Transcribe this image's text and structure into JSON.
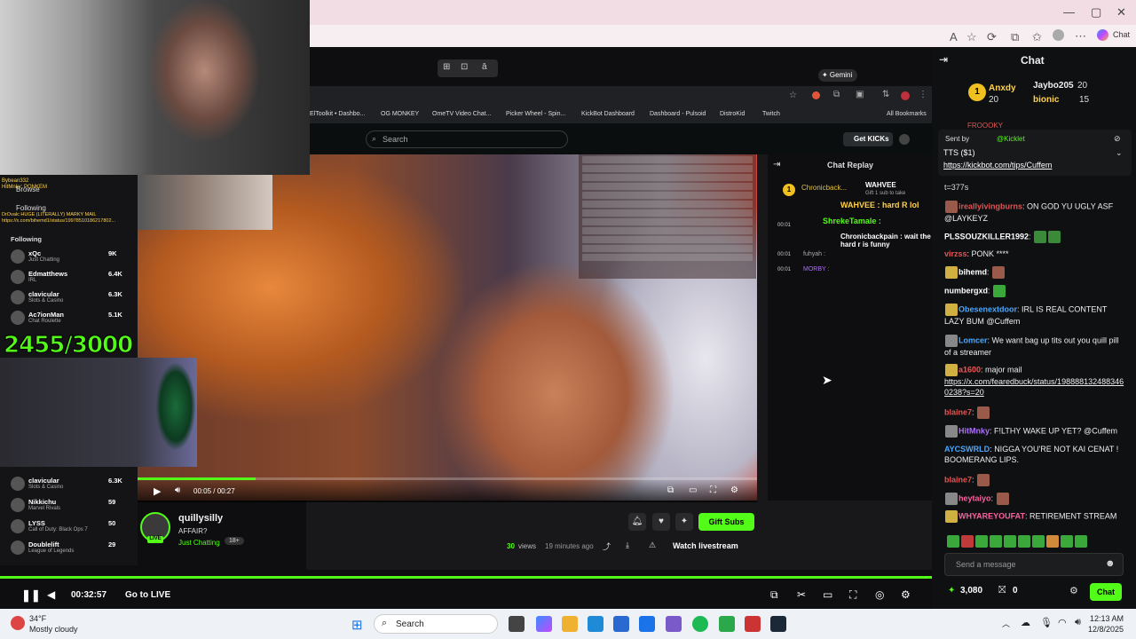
{
  "browser": {
    "chat_label": "Chat",
    "window_controls": [
      "—",
      "▢",
      "✕"
    ]
  },
  "overlay_toolbar": [
    "⊞",
    "⊡",
    "ā"
  ],
  "inner_browser": {
    "gemini_label": "✦ Gemini",
    "bookmarks": [
      "ElToolkit • Dashbo...",
      "OG MONKEY",
      "OmeTV Video Chat...",
      "Picker Wheel - Spin...",
      "KickBot Dashboard",
      "Dashboard - Pulsoid",
      "DistroKid",
      "Twitch",
      "All Bookmarks"
    ]
  },
  "kick": {
    "search_placeholder": "Search",
    "get_kicks": "Get KICKs",
    "chat_replay_title": "Chat Replay",
    "replay_top": {
      "user1": "Chronicback...",
      "user2": "WAHVEE",
      "count": "1",
      "note": "Gift 1 sub to take"
    },
    "replay_lines": [
      {
        "text": "WAHVEE : hard R lol"
      },
      {
        "text": "ShrekeTamale :"
      },
      {
        "time": "00:01",
        "text": "Chronicbackpain : wait the hard r is funny"
      },
      {
        "time": "00:01",
        "text": "fuhyah :"
      },
      {
        "time": "00:01",
        "text": "MORBY :"
      }
    ],
    "video_time": "00:05 / 00:27",
    "video_progress": 0.19,
    "streamer_name": "quillysilly",
    "stream_title": "AFFAIR?",
    "category": "Just Chatting",
    "age_badge": "18+",
    "live_badge": "LIVE",
    "views": "30",
    "views_label": "views",
    "uploaded": "19 minutes ago",
    "gift_subs": "Gift Subs",
    "watch_livestream": "Watch livestream"
  },
  "left_overlay": {
    "browse": "Browse",
    "following": "Following",
    "following_header": "Following",
    "alert_line1": "Bybean332",
    "alert_line2": "HitMnky: PONKEM",
    "alert_line3": "DrOvalc HUGE (LITERALLY) MARKY MAIL",
    "alert_line4": "https://x.com/bihemd1/status/19978510186217802...",
    "counter": "2455/3000",
    "follow_list_top": [
      {
        "name": "xQc",
        "cat": "Just Chatting",
        "viewers": "9K"
      },
      {
        "name": "Edmatthews",
        "cat": "IRL",
        "viewers": "6.4K"
      },
      {
        "name": "clavicular",
        "cat": "Slots & Casino",
        "viewers": "6.3K"
      },
      {
        "name": "Ac7ionMan",
        "cat": "Chat Roulette",
        "viewers": "5.1K"
      }
    ],
    "follow_list_bottom": [
      {
        "name": "clavicular",
        "cat": "Slots & Casino",
        "viewers": "6.3K"
      },
      {
        "name": "Nikkichu",
        "cat": "Marvel Rivals",
        "viewers": "59"
      },
      {
        "name": "LYSS",
        "cat": "Call of Duty: Black Ops 7",
        "viewers": "50"
      },
      {
        "name": "Doublelift",
        "cat": "League of Legends",
        "viewers": "29"
      }
    ]
  },
  "player": {
    "elapsed": "00:32:57",
    "go_live": "Go to LIVE"
  },
  "chat": {
    "title": "Chat",
    "leaderboard": [
      {
        "rank": "1",
        "name": "Anxdy",
        "count": "20"
      },
      {
        "name": "Jaybo205",
        "count": "20"
      },
      {
        "name": "bionic",
        "count": "15"
      }
    ],
    "pinned": {
      "sent_by_label": "Sent by",
      "sent_by": "@Kicklet",
      "title": "TTS ($1)",
      "link": "https://kickbot.com/tips/Cuffem"
    },
    "cut_off_name": "FROOOKY",
    "cut_line": "t=377s",
    "messages": [
      {
        "user": "ireallyivingburns",
        "color": "#e05555",
        "text": "ON GOD YU UGLY ASF @LAYKEYZ"
      },
      {
        "user": "PLSSOUZKILLER1992",
        "color": "#ffffff",
        "text": ""
      },
      {
        "user": "virzss",
        "color": "#e05555",
        "text": "PONK ****"
      },
      {
        "user": "bihemd",
        "color": "#ffffff",
        "text": ""
      },
      {
        "user": "numbergxd",
        "color": "#ffffff",
        "text": ""
      },
      {
        "user": "Obesenextdoor",
        "color": "#4aa8ff",
        "text": "IRL IS REAL CONTENT LAZY BUM @Cuffem"
      },
      {
        "user": "Lomcer",
        "color": "#4aa8ff",
        "text": "We want bag up tits out you quill pill of a streamer"
      },
      {
        "user": "a1600",
        "color": "#ff5050",
        "text": "major mail"
      },
      {
        "user": "",
        "color": "#ffffff",
        "text": "https://x.com/fearedbuck/status/1988881324883460238?s=20"
      },
      {
        "user": "blaine7",
        "color": "#e05555",
        "text": ""
      },
      {
        "user": "HitMnky",
        "color": "#b070ff",
        "text": "F!LTHY WAKE UP YET? @Cuffem"
      },
      {
        "user": "AYCSWRLD",
        "color": "#4aa8ff",
        "text": "NIGGA YOU'RE NOT KAI CENAT ! BOOMERANG LIPS."
      },
      {
        "user": "blaine7",
        "color": "#e05555",
        "text": ""
      },
      {
        "user": "heytaiyo",
        "color": "#ff5fa0",
        "text": ""
      },
      {
        "user": "WHYAREYOUFAT",
        "color": "#ff5fa0",
        "text": "RETIREMENT STREAM"
      }
    ],
    "input_placeholder": "Send a message",
    "kicks_balance": "3,080",
    "gifts_count": "0",
    "send_label": "Chat"
  },
  "taskbar": {
    "temp": "34°F",
    "weather": "Mostly cloudy",
    "search": "Search",
    "time": "12:13 AM",
    "date": "12/8/2025"
  }
}
